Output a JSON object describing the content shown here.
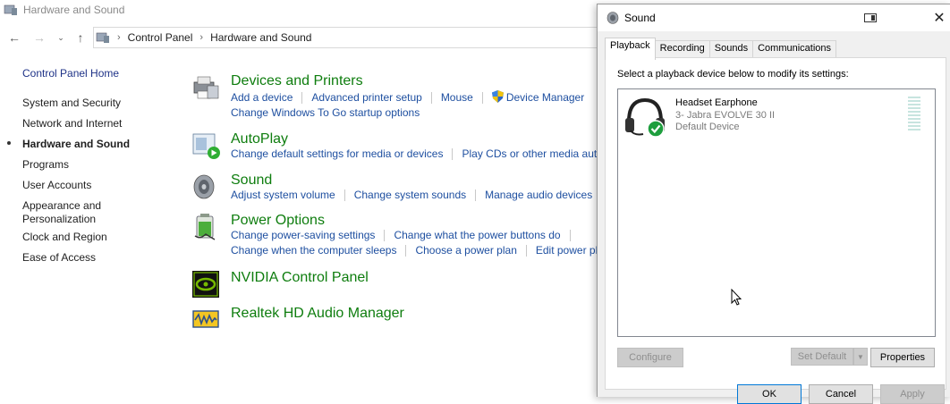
{
  "window": {
    "title": "Hardware and Sound"
  },
  "address": {
    "crumbs": [
      "Control Panel",
      "Hardware and Sound"
    ]
  },
  "sidebar": {
    "items": [
      {
        "label": "Control Panel Home"
      },
      {
        "label": "System and Security"
      },
      {
        "label": "Network and Internet"
      },
      {
        "label": "Hardware and Sound"
      },
      {
        "label": "Programs"
      },
      {
        "label": "User Accounts"
      },
      {
        "label": "Appearance and"
      },
      {
        "label": "Personalization"
      },
      {
        "label": "Clock and Region"
      },
      {
        "label": "Ease of Access"
      }
    ]
  },
  "categories": {
    "devices": {
      "title": "Devices and Printers",
      "links": [
        "Add a device",
        "Advanced printer setup",
        "Mouse",
        "Device Manager",
        "Change Windows To Go startup options"
      ]
    },
    "autoplay": {
      "title": "AutoPlay",
      "links": [
        "Change default settings for media or devices",
        "Play CDs or other media auto"
      ]
    },
    "sound": {
      "title": "Sound",
      "links": [
        "Adjust system volume",
        "Change system sounds",
        "Manage audio devices"
      ]
    },
    "power": {
      "title": "Power Options",
      "links": [
        "Change power-saving settings",
        "Change what the power buttons do",
        "Change when the computer sleeps",
        "Choose a power plan",
        "Edit power pl"
      ]
    },
    "nvidia": {
      "title": "NVIDIA Control Panel"
    },
    "realtek": {
      "title": "Realtek HD Audio Manager"
    }
  },
  "dialog": {
    "title": "Sound",
    "close_label": "✕",
    "tabs": [
      "Playback",
      "Recording",
      "Sounds",
      "Communications"
    ],
    "instruction": "Select a playback device below to modify its settings:",
    "device": {
      "name": "Headset Earphone",
      "sub": "3- Jabra EVOLVE 30 II",
      "status": "Default Device"
    },
    "buttons": {
      "configure": "Configure",
      "set_default": "Set Default",
      "properties": "Properties",
      "ok": "OK",
      "cancel": "Cancel",
      "apply": "Apply"
    }
  },
  "colors": {
    "category_title": "#0e7d0e",
    "link": "#1e4fa0",
    "accent": "#0078d7"
  }
}
